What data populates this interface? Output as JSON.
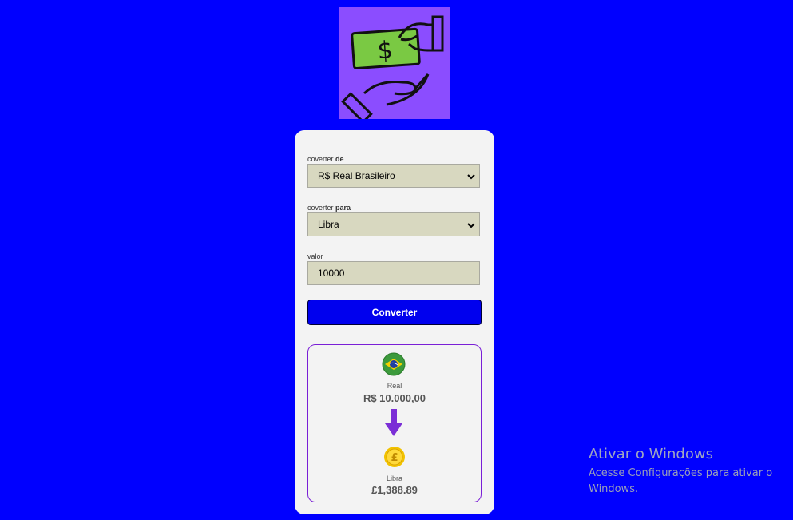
{
  "form": {
    "from_label_prefix": "coverter",
    "from_label_bold": "de",
    "from_value": "R$ Real Brasileiro",
    "to_label_prefix": "coverter",
    "to_label_bold": "para",
    "to_value": "Libra",
    "amount_label": "valor",
    "amount_value": "10000",
    "convert_button": "Converter"
  },
  "result": {
    "from_name": "Real",
    "from_value": "R$ 10.000,00",
    "to_name": "Libra",
    "to_value": "£1,388.89"
  },
  "watermark": {
    "title": "Ativar o Windows",
    "text": "Acesse Configurações para ativar o Windows."
  },
  "icons": {
    "logo": "money-hands-icon",
    "from_flag": "brazil-flag-icon",
    "arrow": "arrow-down-icon",
    "to_coin": "pound-coin-icon"
  },
  "colors": {
    "background": "#0000ff",
    "logo_bg": "#8b4dff",
    "button": "#0000ee",
    "result_border": "#7a1fd6",
    "arrow": "#7b2fd6"
  }
}
